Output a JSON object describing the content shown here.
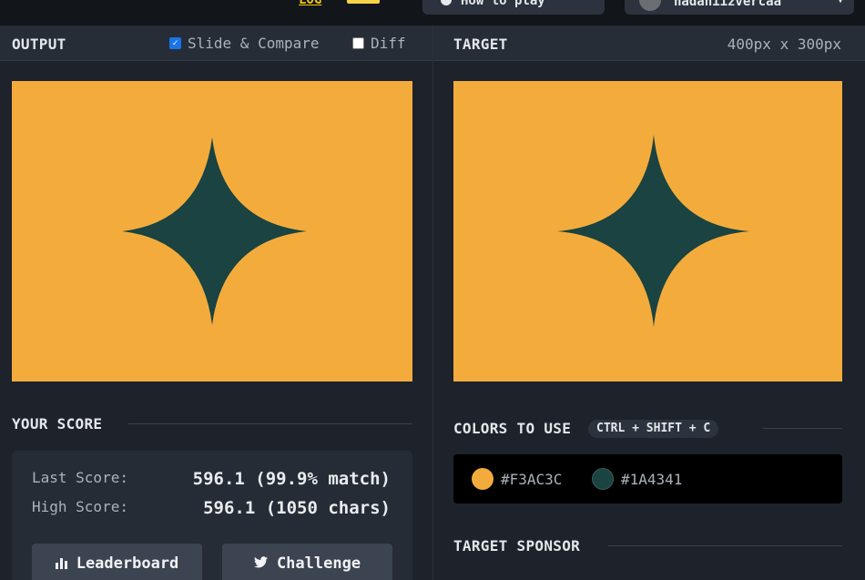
{
  "topbar": {
    "link_text": "LOG",
    "howto_label": "How to play",
    "user_label": "nadaniizvercaa"
  },
  "output": {
    "title": "OUTPUT",
    "slide_compare_label": "Slide & Compare",
    "slide_compare_checked": true,
    "diff_label": "Diff",
    "diff_checked": false
  },
  "target": {
    "title": "TARGET",
    "dimensions": "400px x 300px"
  },
  "score": {
    "title": "YOUR SCORE",
    "last_label": "Last Score:",
    "last_value": "596.1 (99.9% match)",
    "high_label": "High Score:",
    "high_value": "596.1 (1050 chars)",
    "leaderboard_label": "Leaderboard",
    "challenge_label": "Challenge"
  },
  "colors": {
    "title": "COLORS TO USE",
    "shortcut": "CTRL + SHIFT + C",
    "items": [
      {
        "hex": "#F3AC3C",
        "label": "#F3AC3C"
      },
      {
        "hex": "#1A4341",
        "label": "#1A4341"
      }
    ]
  },
  "sponsor": {
    "title": "TARGET SPONSOR"
  }
}
